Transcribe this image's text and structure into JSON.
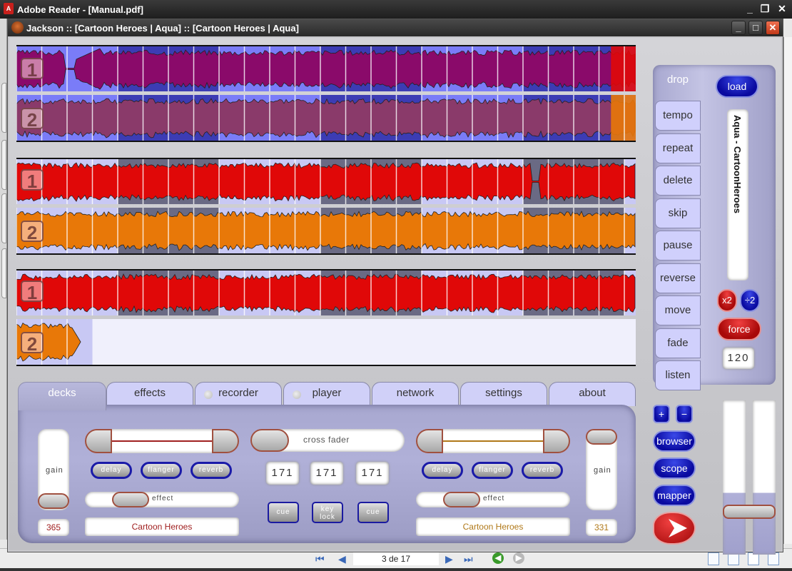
{
  "outer_window": {
    "title": "Adobe Reader - [Manual.pdf]",
    "icon": "adobe-reader-icon",
    "controls": {
      "minimize": "_",
      "restore": "❐",
      "close": "✕"
    }
  },
  "pdf_toolbar": {
    "first_page": "first-page-icon",
    "prev_page": "previous-page-icon",
    "page_indicator": "3 de 17",
    "next_page": "next-page-icon",
    "last_page": "last-page-icon",
    "go_back": "go-back-icon",
    "go_forward": "go-forward-icon",
    "view_modes": [
      "single-page",
      "continuous",
      "facing",
      "continuous-facing"
    ]
  },
  "app_window": {
    "title": "Jackson :: [Cartoon Heroes  | Aqua] :: [Cartoon Heroes  | Aqua]",
    "icon": "jackson-app-icon",
    "controls": {
      "minimize": "_",
      "maximize": "□",
      "close": "✕"
    }
  },
  "waveforms": {
    "colors": {
      "purple_fill": "#8a0a6a",
      "mauve_fill": "#8a3a6a",
      "blue_bg": "#7a7cf8",
      "blue_dark": "#3c3cb4",
      "red_fill": "#e00808",
      "orange_fill": "#e87808",
      "lavender_bg": "#c8c8f4",
      "slate_bg": "#6a6a84"
    },
    "overview": [
      {
        "label": "1",
        "progress_pct": 96
      },
      {
        "label": "2",
        "progress_pct": 96
      }
    ],
    "zoomed_a": [
      {
        "label": "1"
      },
      {
        "label": "2"
      }
    ],
    "zoomed_b": [
      {
        "label": "1"
      },
      {
        "label": "2",
        "loaded_pct": 12
      }
    ]
  },
  "side_panel": {
    "drop_label": "drop",
    "load_label": "load",
    "commands": [
      "tempo",
      "repeat",
      "delete",
      "skip",
      "pause",
      "reverse",
      "move",
      "fade",
      "listen"
    ],
    "track_title": "Aqua - CartoonHeroes",
    "double_label": "x2",
    "half_label": "÷2",
    "force_label": "force",
    "bpm_value": "120"
  },
  "tabs": [
    {
      "label": "decks",
      "active": true,
      "led": false
    },
    {
      "label": "effects",
      "active": false,
      "led": false
    },
    {
      "label": "recorder",
      "active": false,
      "led": true
    },
    {
      "label": "player",
      "active": false,
      "led": true
    },
    {
      "label": "network",
      "active": false,
      "led": false
    },
    {
      "label": "settings",
      "active": false,
      "led": false
    },
    {
      "label": "about",
      "active": false,
      "led": false
    }
  ],
  "decks": {
    "left": {
      "gain_label": "gain",
      "gain_value": "365",
      "gain_level_pct": 5,
      "effects": [
        "delay",
        "flanger",
        "reverb"
      ],
      "effect_label": "effect",
      "effect_level_pct": 28,
      "track_name": "Cartoon Heroes",
      "accent": "#a02020"
    },
    "center": {
      "cross_fader_label": "cross fader",
      "cross_fader_pct": 0,
      "bpm_values": [
        "171",
        "171",
        "171"
      ],
      "cue_left_label": "cue",
      "key_lock_label": "key\nlock",
      "cue_right_label": "cue"
    },
    "right": {
      "gain_label": "gain",
      "gain_value": "331",
      "gain_level_pct": 95,
      "effects": [
        "delay",
        "flanger",
        "reverb"
      ],
      "effect_label": "effect",
      "effect_level_pct": 28,
      "track_name": "Cartoon Heroes",
      "accent": "#b07818"
    }
  },
  "tools": {
    "plus_label": "+",
    "minus_label": "−",
    "browser_label": "browser",
    "scope_label": "scope",
    "mapper_label": "mapper",
    "play_icon": "play-arrow-icon",
    "master_level_pct": 30
  }
}
